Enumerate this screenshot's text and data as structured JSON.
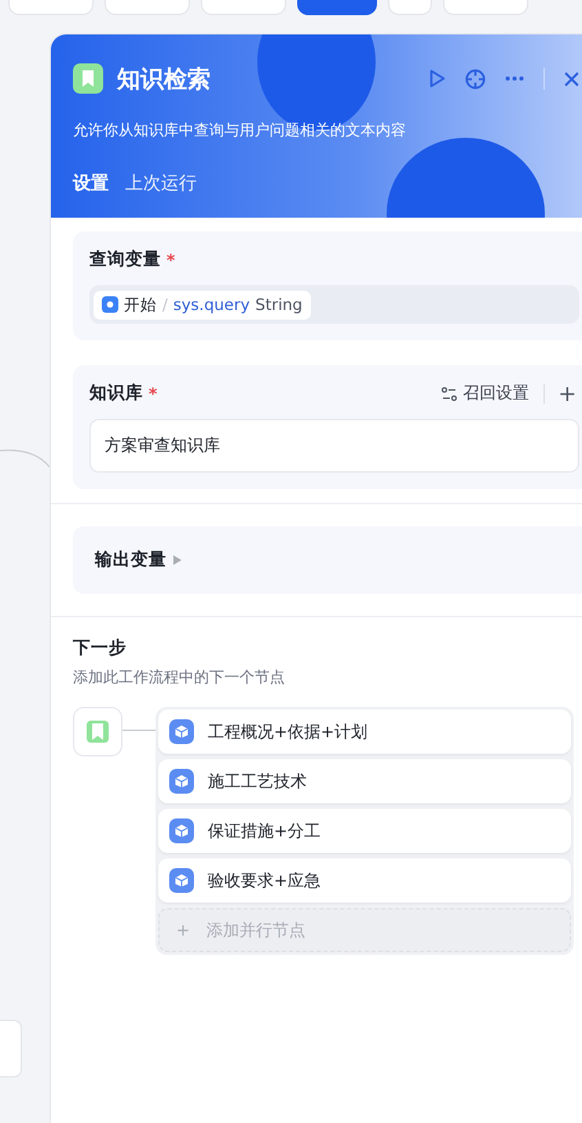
{
  "panel": {
    "title": "知识检索",
    "description": "允许你从知识库中查询与用户问题相关的文本内容",
    "tabs": [
      {
        "label": "设置",
        "selected": true
      },
      {
        "label": "上次运行",
        "selected": false
      }
    ],
    "query_variable": {
      "label": "查询变量",
      "required_mark": "*",
      "source": "开始",
      "separator": "/",
      "variable": "sys.query",
      "type": "String"
    },
    "knowledge_base": {
      "label": "知识库",
      "required_mark": "*",
      "action": "召回设置",
      "add": "+",
      "items": [
        "方案审查知识库"
      ]
    },
    "output_variables": {
      "label": "输出变量",
      "expanded": false
    },
    "next_step": {
      "title": "下一步",
      "description": "添加此工作流程中的下一个节点",
      "branches": [
        "工程概况+依据+计划",
        "施工工艺技术",
        "保证措施+分工",
        "验收要求+应急"
      ],
      "add_parallel": {
        "icon": "+",
        "label": "添加并行节点"
      }
    }
  }
}
